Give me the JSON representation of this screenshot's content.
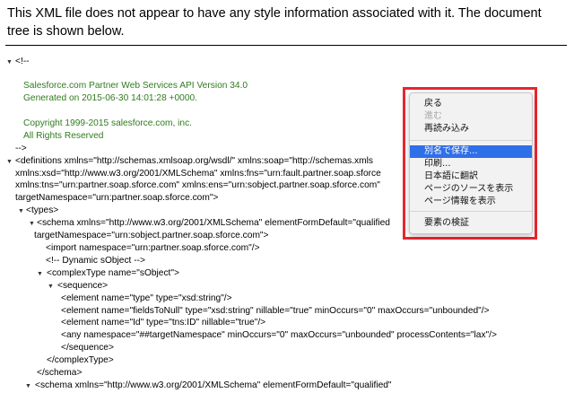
{
  "notice": "This XML file does not appear to have any style information associated with it. The document tree is shown below.",
  "lines": [
    {
      "t": "▼",
      "i": "<!--",
      "c": false
    },
    {
      "t": "",
      "i": "",
      "c": false
    },
    {
      "t": "",
      "i": "Salesforce.com Partner Web Services API Version 34.0",
      "c": true
    },
    {
      "t": "",
      "i": "Generated on 2015-06-30 14:01:28 +0000.",
      "c": true
    },
    {
      "t": "",
      "i": "",
      "c": false
    },
    {
      "t": "",
      "i": "Copyright 1999-2015 salesforce.com, inc.",
      "c": true
    },
    {
      "t": "",
      "i": "All Rights Reserved",
      "c": true
    },
    {
      "t": "",
      "i": "-->",
      "c": false
    },
    {
      "t": "▼",
      "i": "<definitions xmlns=\"http://schemas.xmlsoap.org/wsdl/\" xmlns:soap=\"http://schemas.xmls",
      "c": false
    },
    {
      "t": "",
      "i": "xmlns:xsd=\"http://www.w3.org/2001/XMLSchema\" xmlns:fns=\"urn:fault.partner.soap.sforce",
      "c": false
    },
    {
      "t": "",
      "i": "xmlns:tns=\"urn:partner.soap.sforce.com\" xmlns:ens=\"urn:sobject.partner.soap.sforce.com\"",
      "c": false
    },
    {
      "t": "",
      "i": "targetNamespace=\"urn:partner.soap.sforce.com\">",
      "c": false
    },
    {
      "t": "▼",
      "i": "<types>",
      "c": false
    },
    {
      "t": "▼",
      "i": "<schema xmlns=\"http://www.w3.org/2001/XMLSchema\" elementFormDefault=\"qualified",
      "c": false
    },
    {
      "t": "",
      "i": "targetNamespace=\"urn:sobject.partner.soap.sforce.com\">",
      "c": false
    },
    {
      "t": "",
      "i": "<import namespace=\"urn:partner.soap.sforce.com\"/>",
      "c": false
    },
    {
      "t": "",
      "i": "<!--  Dynamic sObject  -->",
      "c": false
    },
    {
      "t": "▼",
      "i": "<complexType name=\"sObject\">",
      "c": false
    },
    {
      "t": "▼",
      "i": "<sequence>",
      "c": false
    },
    {
      "t": "",
      "i": "<element name=\"type\" type=\"xsd:string\"/>",
      "c": false
    },
    {
      "t": "",
      "i": "<element name=\"fieldsToNull\" type=\"xsd:string\" nillable=\"true\" minOccurs=\"0\" maxOccurs=\"unbounded\"/>",
      "c": false
    },
    {
      "t": "",
      "i": "<element name=\"Id\" type=\"tns:ID\" nillable=\"true\"/>",
      "c": false
    },
    {
      "t": "",
      "i": "<any namespace=\"##targetNamespace\" minOccurs=\"0\" maxOccurs=\"unbounded\" processContents=\"lax\"/>",
      "c": false
    },
    {
      "t": "",
      "i": "</sequence>",
      "c": false
    },
    {
      "t": "",
      "i": "</complexType>",
      "c": false
    },
    {
      "t": "",
      "i": "</schema>",
      "c": false
    },
    {
      "t": "▼",
      "i": "<schema xmlns=\"http://www.w3.org/2001/XMLSchema\" elementFormDefault=\"qualified\"",
      "c": false
    }
  ],
  "context_menu": {
    "items": [
      {
        "label": "戻る",
        "state": "normal"
      },
      {
        "label": "進む",
        "state": "disabled"
      },
      {
        "label": "再読み込み",
        "state": "normal"
      },
      {
        "label": "別名で保存...",
        "state": "selected"
      },
      {
        "label": "印刷...",
        "state": "normal"
      },
      {
        "label": "日本語に翻訳",
        "state": "normal"
      },
      {
        "label": "ページのソースを表示",
        "state": "normal"
      },
      {
        "label": "ページ情報を表示",
        "state": "normal"
      },
      {
        "label": "要素の検証",
        "state": "normal"
      }
    ]
  }
}
